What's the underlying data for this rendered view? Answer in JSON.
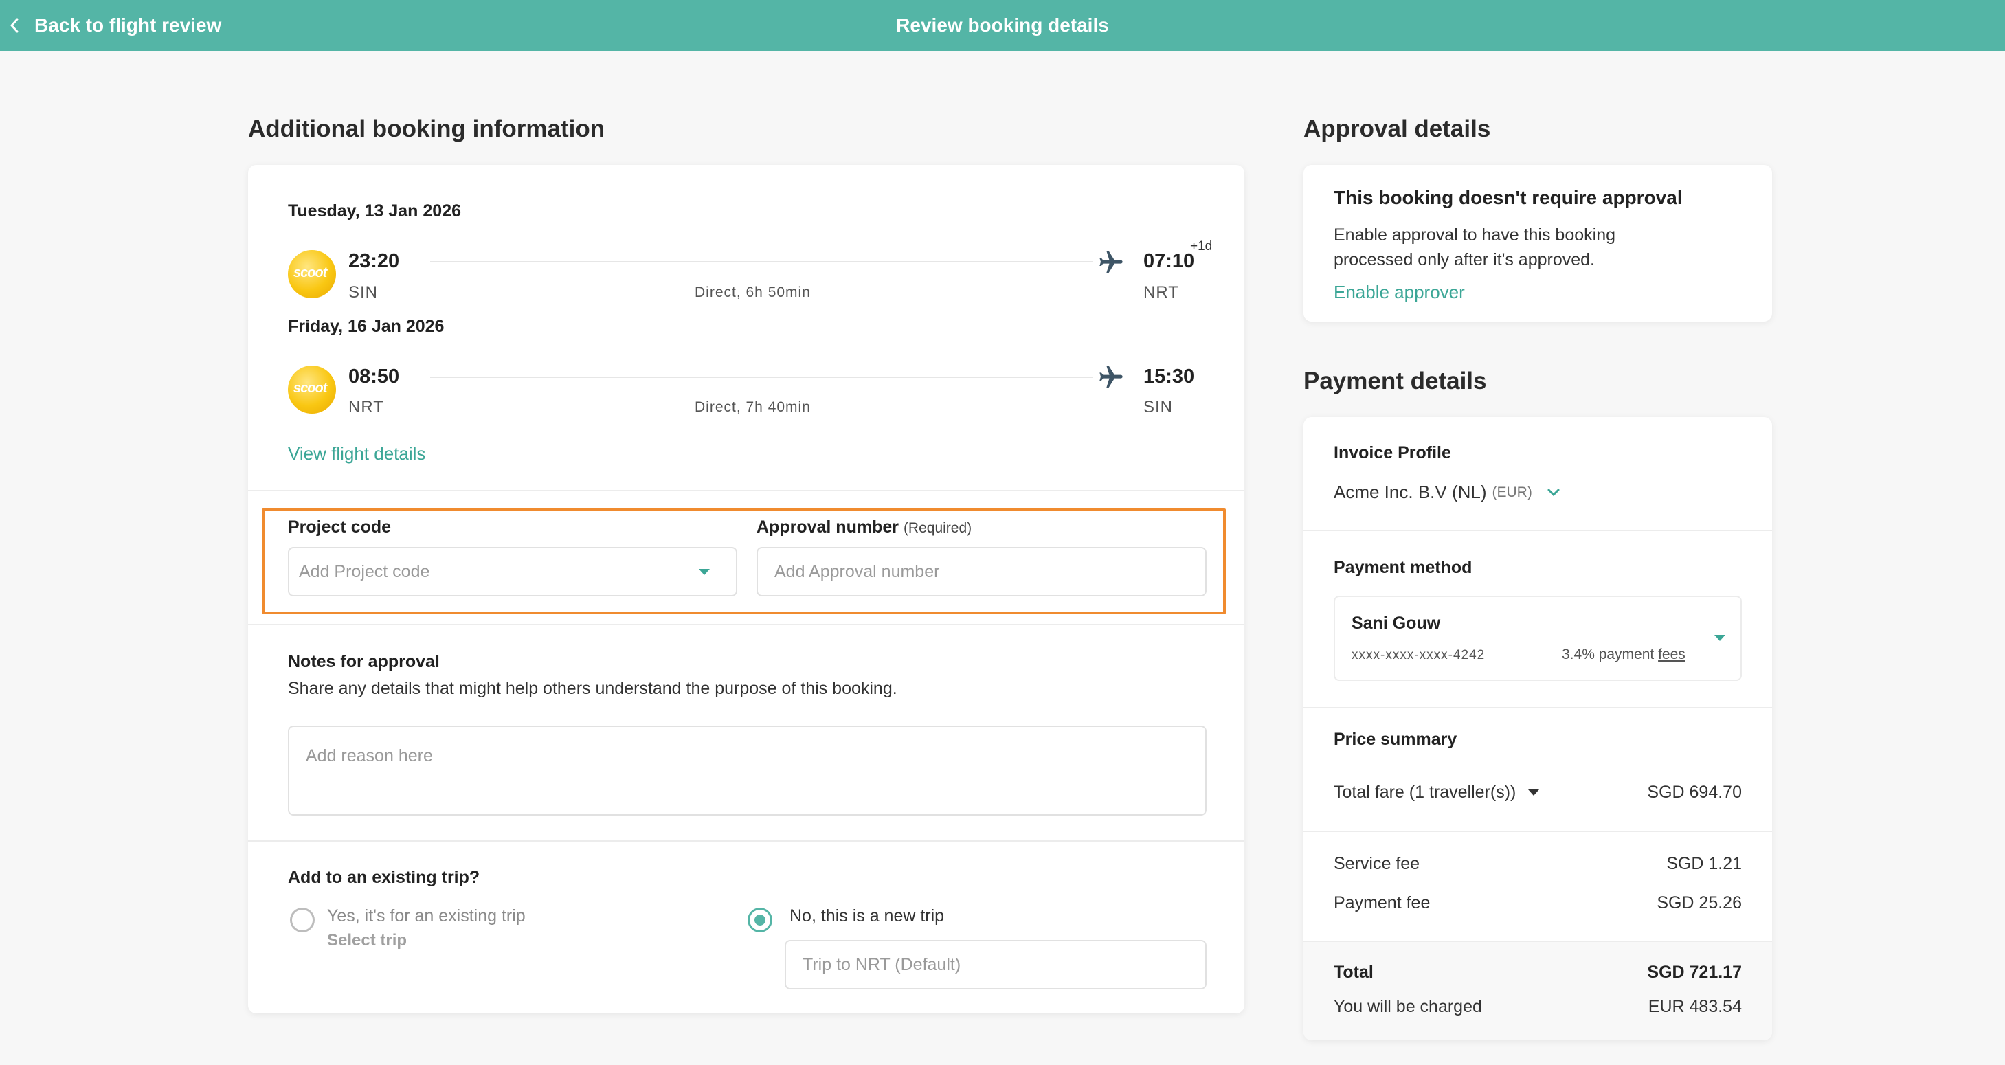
{
  "topbar": {
    "back_label": "Back to flight review",
    "title": "Review booking details"
  },
  "booking": {
    "heading": "Additional booking information",
    "flights": [
      {
        "date": "Tuesday, 13 Jan 2026",
        "airline_logo": "scoot",
        "depart_time": "23:20",
        "depart_code": "SIN",
        "duration": "Direct, 6h 50min",
        "arrive_time": "07:10",
        "arrive_code": "NRT",
        "plus_day": "+1d"
      },
      {
        "date": "Friday, 16 Jan 2026",
        "airline_logo": "scoot",
        "depart_time": "08:50",
        "depart_code": "NRT",
        "duration": "Direct, 7h 40min",
        "arrive_time": "15:30",
        "arrive_code": "SIN"
      }
    ],
    "view_details_label": "View flight details",
    "project_code": {
      "label": "Project code",
      "placeholder": "Add Project code"
    },
    "approval_number": {
      "label": "Approval number",
      "required": "(Required)",
      "placeholder": "Add Approval number"
    },
    "notes": {
      "label": "Notes for approval",
      "description": "Share any details that might help others understand the purpose of this booking.",
      "placeholder": "Add reason here"
    },
    "trip": {
      "label": "Add to an existing trip?",
      "option_existing": "Yes, it's for an existing trip",
      "select_trip": "Select trip",
      "option_new": "No, this is a new trip",
      "new_trip_placeholder": "Trip to NRT (Default)",
      "selected": "new"
    }
  },
  "approval": {
    "heading": "Approval details",
    "title": "This booking doesn't require approval",
    "description_line1": "Enable approval to have this booking",
    "description_line2": "processed only after it's approved.",
    "enable_label": "Enable approver"
  },
  "payment": {
    "heading": "Payment details",
    "invoice_label": "Invoice Profile",
    "invoice_value": "Acme Inc. B.V (NL)",
    "invoice_currency": "(EUR)",
    "method_label": "Payment method",
    "method_name": "Sani Gouw",
    "method_card": "xxxx-xxxx-xxxx-4242",
    "method_fee_text": "3.4% payment",
    "method_fee_link": "fees",
    "price_summary_label": "Price summary",
    "total_fare_label": "Total fare (1 traveller(s))",
    "total_fare_value": "SGD 694.70",
    "service_fee_label": "Service fee",
    "service_fee_value": "SGD 1.21",
    "payment_fee_label": "Payment fee",
    "payment_fee_value": "SGD 25.26",
    "total_label": "Total",
    "total_value": "SGD 721.17",
    "charged_label": "You will be charged",
    "charged_value": "EUR 483.54"
  },
  "colors": {
    "brand": "#54b5a6",
    "link": "#3ba696",
    "highlight": "#f08b2f"
  }
}
